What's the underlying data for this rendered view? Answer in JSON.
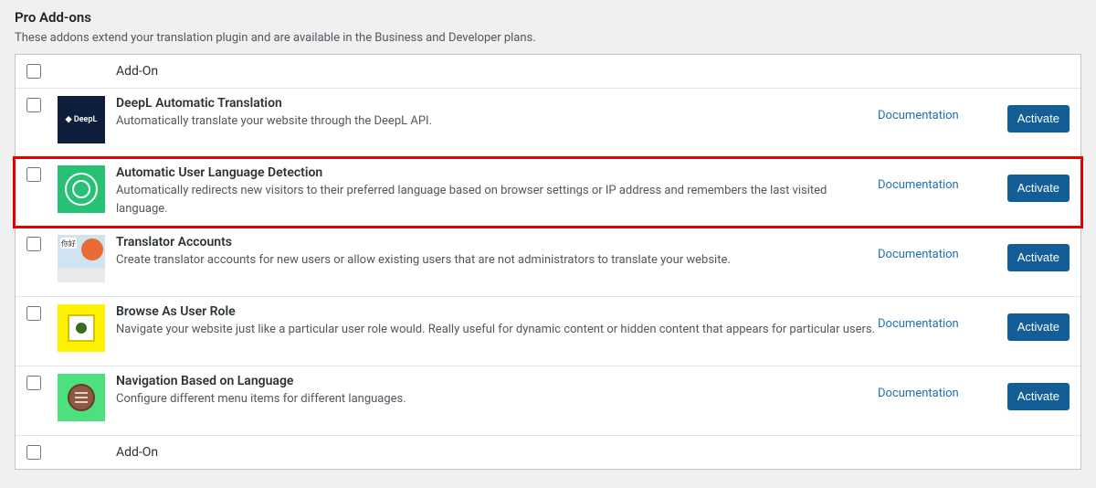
{
  "page": {
    "title": "Pro Add-ons",
    "description": "These addons extend your translation plugin and are available in the Business and Developer plans."
  },
  "column_header": "Add-On",
  "column_footer": "Add-On",
  "labels": {
    "documentation": "Documentation",
    "activate": "Activate"
  },
  "addons": [
    {
      "icon_class": "icon-deepl",
      "icon_type": "deepl",
      "title": "DeepL Automatic Translation",
      "description": "Automatically translate your website through the DeepL API.",
      "highlighted": false
    },
    {
      "icon_class": "icon-lang",
      "icon_type": "wifi",
      "title": "Automatic User Language Detection",
      "description": "Automatically redirects new visitors to their preferred language based on browser settings or IP address and remembers the last visited language.",
      "highlighted": true
    },
    {
      "icon_class": "icon-trans",
      "icon_type": "translator",
      "title": "Translator Accounts",
      "description": "Create translator accounts for new users or allow existing users that are not administrators to translate your website.",
      "highlighted": false
    },
    {
      "icon_class": "icon-browse",
      "icon_type": "eye",
      "title": "Browse As User Role",
      "description": "Navigate your website just like a particular user role would. Really useful for dynamic content or hidden content that appears for particular users.",
      "highlighted": false
    },
    {
      "icon_class": "icon-nav",
      "icon_type": "burger",
      "title": "Navigation Based on Language",
      "description": "Configure different menu items for different languages.",
      "highlighted": false
    }
  ]
}
